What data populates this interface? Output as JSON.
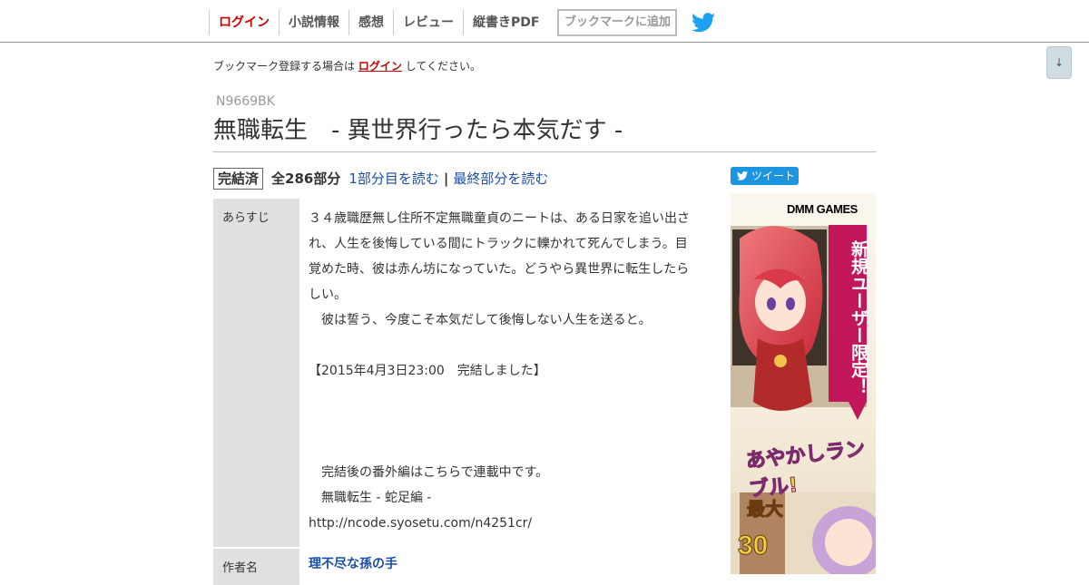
{
  "nav": {
    "items": [
      {
        "label": "ログイン",
        "type": "login"
      },
      {
        "label": "小説情報"
      },
      {
        "label": "感想"
      },
      {
        "label": "レビュー"
      },
      {
        "label": "縦書きPDF"
      }
    ],
    "bookmark_button": "ブックマークに追加",
    "twitter_icon": "twitter-bird-icon"
  },
  "scroll_button": "↓",
  "notice": {
    "prefix": "ブックマーク登録する場合は",
    "link": "ログイン",
    "suffix": "してください。"
  },
  "novel": {
    "ncode": "N9669BK",
    "title": "無職転生　- 異世界行ったら本気だす -",
    "status": "完結済",
    "episodes": "全286部分",
    "read_first": "1部分目を読む",
    "separator": "|",
    "read_last": "最終部分を読む",
    "tweet": "ツイート",
    "synopsis_label": "あらすじ",
    "synopsis": "３４歳職歴無し住所不定無職童貞のニートは、ある日家を追い出され、人生を後悔している間にトラックに轢かれて死んでしまう。目覚めた時、彼は赤ん坊になっていた。どうやら異世界に転生したらしい。\n　彼は誓う、今度こそ本気だして後悔しない人生を送ると。\n\n【2015年4月3日23:00　完結しました】\n\n\n\n　完結後の番外編はこちらで連載中です。\n　無職転生 - 蛇足編 -\nhttp://ncode.syosetu.com/n4251cr/",
    "author_label": "作者名",
    "author": "理不尽な孫の手"
  },
  "ad": {
    "logo": "DMM GAMES",
    "new_user": "新規ユーザー限定！",
    "game_title": "あやかしランブル!",
    "max": "最大",
    "number": "30"
  },
  "colors": {
    "login_red": "#cc0000",
    "link_blue": "#1a4ea8",
    "label_bg": "#e0e0e0",
    "twitter_blue": "#1b95e0"
  }
}
